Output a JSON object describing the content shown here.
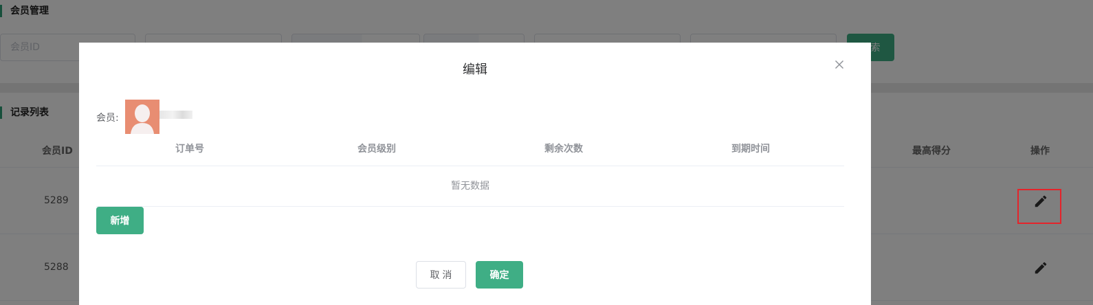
{
  "page": {
    "member_section_title": "会员管理",
    "records_section_title": "记录列表",
    "search": {
      "member_id_placeholder": "会员ID",
      "search_button": "搜索"
    },
    "table": {
      "headers": {
        "member_id": "会员ID",
        "max_score": "最高得分",
        "actions": "操作"
      },
      "rows": [
        {
          "member_id": "5289"
        },
        {
          "member_id": "5288"
        }
      ]
    }
  },
  "dialog": {
    "title": "编辑",
    "member_label": "会员:",
    "columns": [
      "订单号",
      "会员级别",
      "剩余次数",
      "到期时间"
    ],
    "empty_text": "暂无数据",
    "add_button": "新增",
    "cancel_button": "取 消",
    "confirm_button": "确定"
  },
  "colors": {
    "accent": "#3fae85",
    "highlight": "#e5232a"
  },
  "icons": {
    "close": "close-icon",
    "edit": "pencil-icon",
    "avatar": "user-silhouette"
  }
}
